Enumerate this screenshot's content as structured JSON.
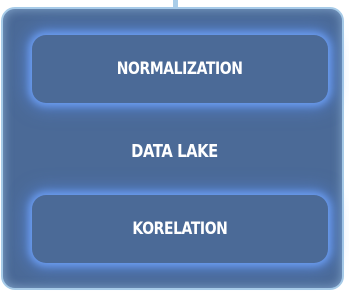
{
  "diagram": {
    "top_node": {
      "label": "NORMALIZATION"
    },
    "center_label": "DATA LAKE",
    "bottom_node": {
      "label": "KORELATION"
    },
    "colors": {
      "panel_fill": "#4b6a97",
      "panel_border": "#a7cbe8",
      "node_glow": "#6ea0f5",
      "text": "#ffffff"
    }
  }
}
